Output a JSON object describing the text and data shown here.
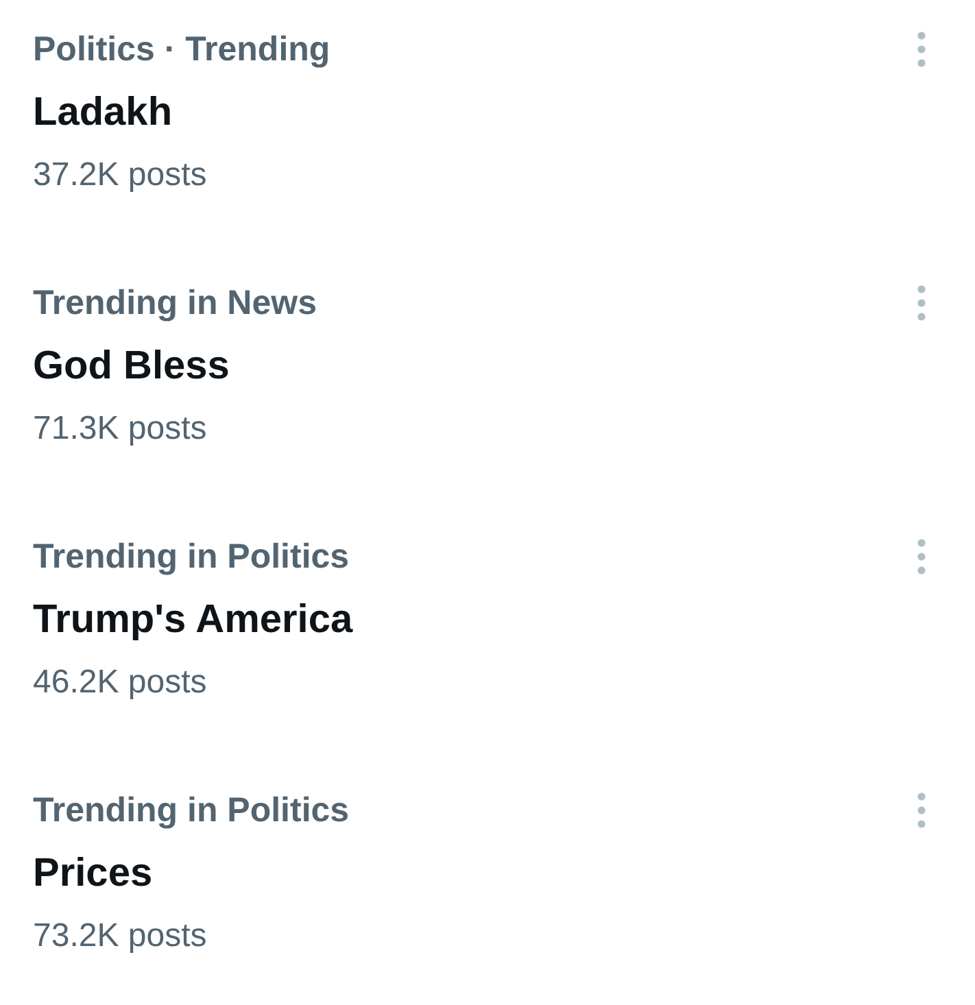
{
  "trends": [
    {
      "context": "Politics · Trending",
      "title": "Ladakh",
      "posts": "37.2K posts"
    },
    {
      "context": "Trending in News",
      "title": "God Bless",
      "posts": "71.3K posts"
    },
    {
      "context": "Trending in Politics",
      "title": "Trump's America",
      "posts": "46.2K posts"
    },
    {
      "context": "Trending in Politics",
      "title": "Prices",
      "posts": "73.2K posts"
    }
  ]
}
